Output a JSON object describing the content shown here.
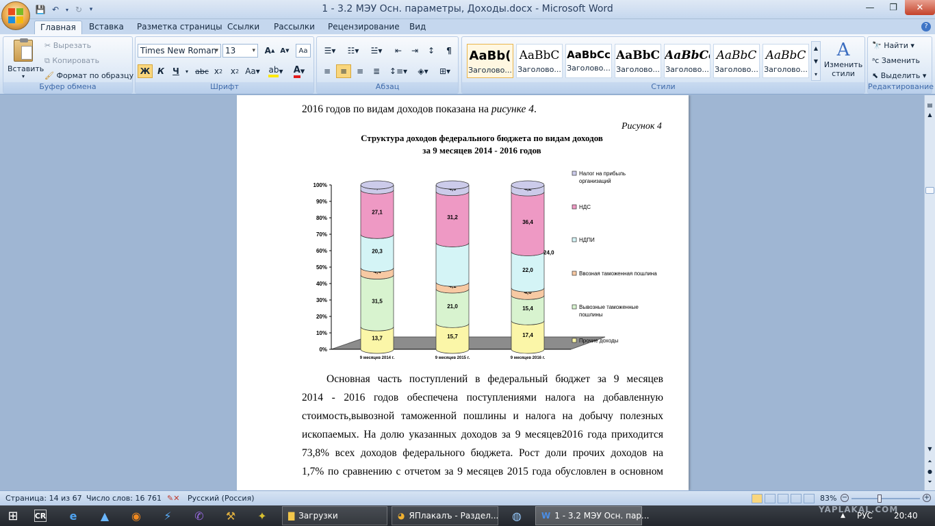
{
  "window": {
    "title": "1 - 3.2 МЭУ Осн. параметры, Доходы.docx - Microsoft Word"
  },
  "tabs": [
    "Главная",
    "Вставка",
    "Разметка страницы",
    "Ссылки",
    "Рассылки",
    "Рецензирование",
    "Вид"
  ],
  "clipboard": {
    "paste": "Вставить",
    "cut": "Вырезать",
    "copy": "Копировать",
    "format_painter": "Формат по образцу",
    "label": "Буфер обмена"
  },
  "font": {
    "name": "Times New Roman",
    "size": "13",
    "label": "Шрифт"
  },
  "paragraph": {
    "label": "Абзац"
  },
  "styles": {
    "label": "Стили",
    "items": [
      {
        "sample": "AaBb(",
        "name": "Заголово..."
      },
      {
        "sample": "AaBbC",
        "name": "Заголово..."
      },
      {
        "sample": "AaBbCc",
        "name": "Заголово..."
      },
      {
        "sample": "AaBbC",
        "name": "Заголово..."
      },
      {
        "sample": "AaBbCc",
        "name": "Заголово..."
      },
      {
        "sample": "AaBbC",
        "name": "Заголово..."
      },
      {
        "sample": "AaBbC",
        "name": "Заголово..."
      }
    ],
    "change": "Изменить стили"
  },
  "editing": {
    "label": "Редактирование",
    "find": "Найти",
    "replace": "Заменить",
    "select": "Выделить"
  },
  "document": {
    "top_line_pre": "2016 годов по видам доходов показана на ",
    "top_line_italic": "рисунке 4",
    "top_line_post": ".",
    "figure_label": "Рисунок 4",
    "chart_title_1": "Структура доходов федерального  бюджета  по видам доходов",
    "chart_title_2": "за 9 месяцев 2014 - 2016 годов",
    "paragraph_lines": [
      "Основная часть поступлений в федеральный бюджет за 9 месяцев",
      "2014 - 2016 годов обеспечена поступлениями налога на добавленную",
      "стоимость,вывозной таможенной пошлины и налога на добычу полезных",
      "ископаемых. На долю указанных доходов за 9 месяцев2016 года приходится",
      "73,8% всех доходов федерального бюджета. Рост доли прочих доходов на",
      "1,7% по сравнению с отчетом за  9 месяцев 2015 года обусловлен в основном"
    ]
  },
  "chart_data": {
    "type": "bar",
    "stacked": true,
    "title": "Структура доходов федерального  бюджета  по видам доходов за 9 месяцев 2014 - 2016 годов",
    "categories": [
      "9 месяцев 2014 г.",
      "9 месяцев 2015 г.",
      "9 месяцев 2016 г."
    ],
    "yticks": [
      "0%",
      "10%",
      "20%",
      "30%",
      "40%",
      "50%",
      "60%",
      "70%",
      "80%",
      "90%",
      "100%"
    ],
    "ylim": [
      0,
      100
    ],
    "legend_position": "right",
    "series": [
      {
        "name": "Прочие доходы",
        "values": [
          13.7,
          15.7,
          17.4
        ],
        "labels": [
          "13,7",
          "15,7",
          "17,4"
        ],
        "color": "#fbf6a8"
      },
      {
        "name": "Вывозные таможенные пошлины",
        "values": [
          31.5,
          21.0,
          15.4
        ],
        "labels": [
          "31,5",
          "21,0",
          "15,4"
        ],
        "color": "#d8f3cf"
      },
      {
        "name": "Ввозная таможенная пошлина",
        "values": [
          4.4,
          4.1,
          4.6
        ],
        "labels": [
          "4,4",
          "4,1",
          "4,6"
        ],
        "color": "#f7c9a3"
      },
      {
        "name": "НДПИ",
        "values": [
          20.3,
          24.0,
          22.0
        ],
        "labels": [
          "20,3",
          "",
          "22,0"
        ],
        "color": "#d4f4f6"
      },
      {
        "name": "НДС",
        "values": [
          27.1,
          31.2,
          36.4
        ],
        "labels": [
          "27,1",
          "31,2",
          "36,4"
        ],
        "color": "#ee99c4"
      },
      {
        "name": "Налог на прибыль организаций",
        "values": [
          3.0,
          4.0,
          4.2
        ],
        "labels": [
          "3,0",
          "4,0",
          "4,2"
        ],
        "color": "#cccbea"
      }
    ],
    "extra_label": "24,0",
    "legend_lines": [
      [
        "Налог на прибыль",
        "организаций"
      ],
      [
        "НДС"
      ],
      [
        "НДПИ"
      ],
      [
        "Ввозная таможенная пошлина"
      ],
      [
        "Вывозные таможенные",
        "пошлины"
      ],
      [
        "Прочие доходы"
      ]
    ]
  },
  "status": {
    "page": "Страница: 14 из 67",
    "words": "Число слов: 16 761",
    "language": "Русский (Россия)",
    "zoom": "83%"
  },
  "taskbar": {
    "windows": [
      {
        "label": "Загрузки"
      },
      {
        "label": "ЯПлакалъ - Раздел..."
      },
      {
        "label": "1 - 3.2 МЭУ Осн. пар..."
      }
    ],
    "lang": "РУС",
    "time": "20:40",
    "watermark": "YAPLAKAL.COM"
  }
}
